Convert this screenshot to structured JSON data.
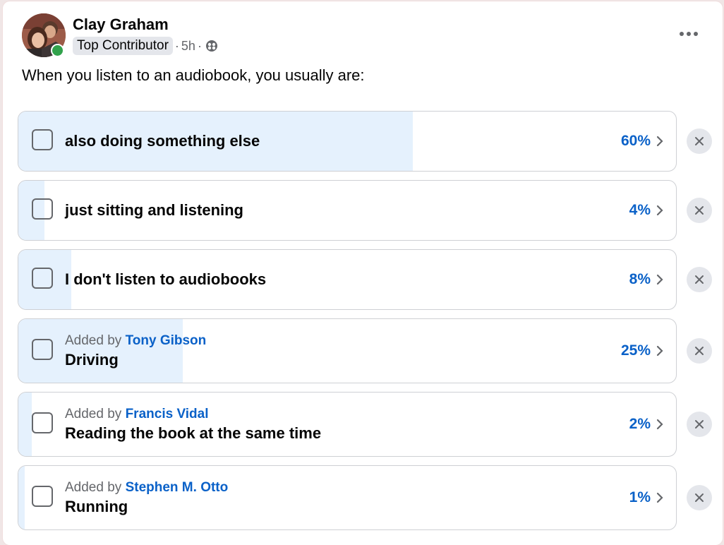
{
  "post": {
    "author": "Clay Graham",
    "badge": "Top Contributor",
    "separator": "·",
    "time": "5h",
    "question": "When you listen to an audiobook, you usually are:"
  },
  "poll": {
    "options": [
      {
        "label": "also doing something else",
        "percent_text": "60%",
        "percent": 60,
        "added_by_prefix": "",
        "added_by_name": ""
      },
      {
        "label": "just sitting and listening",
        "percent_text": "4%",
        "percent": 4,
        "added_by_prefix": "",
        "added_by_name": ""
      },
      {
        "label": "I don't listen to audiobooks",
        "percent_text": "8%",
        "percent": 8,
        "added_by_prefix": "",
        "added_by_name": ""
      },
      {
        "label": "Driving",
        "percent_text": "25%",
        "percent": 25,
        "added_by_prefix": "Added by",
        "added_by_name": "Tony Gibson"
      },
      {
        "label": "Reading the book at the same time",
        "percent_text": "2%",
        "percent": 2,
        "added_by_prefix": "Added by",
        "added_by_name": "Francis Vidal"
      },
      {
        "label": "Running",
        "percent_text": "1%",
        "percent": 1,
        "added_by_prefix": "Added by",
        "added_by_name": "Stephen M. Otto"
      }
    ]
  },
  "icons": {
    "audience": "globe-icon",
    "more": "more-horizontal-icon",
    "remove": "close-icon",
    "open_voters": "chevron-right-icon"
  },
  "colors": {
    "accent": "#0a61c8",
    "bar_fill": "#e5f1fd",
    "online": "#31a24c"
  }
}
